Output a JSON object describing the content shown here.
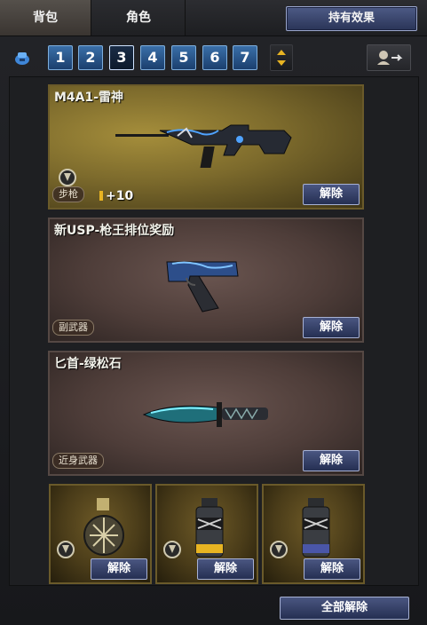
{
  "tabs": [
    {
      "label": "背包"
    },
    {
      "label": "角色"
    }
  ],
  "header": {
    "holding_effect_label": "持有效果"
  },
  "pagination": {
    "pages": [
      "1",
      "2",
      "3",
      "4",
      "5",
      "6",
      "7"
    ],
    "active_page": "3"
  },
  "cards": [
    {
      "title": "M4A1-雷神",
      "type": "步枪",
      "bonus": "+10",
      "unequip_label": "解除",
      "weapon_icon": "rifle-icon"
    },
    {
      "title": "新USP-枪王排位奖励",
      "type": "副武器",
      "unequip_label": "解除",
      "weapon_icon": "pistol-icon"
    },
    {
      "title": "匕首-绿松石",
      "type": "近身武器",
      "unequip_label": "解除",
      "weapon_icon": "knife-icon"
    }
  ],
  "slots": [
    {
      "unequip_label": "解除",
      "item_icon": "frag-grenade-icon"
    },
    {
      "unequip_label": "解除",
      "item_icon": "smoke-grenade-icon"
    },
    {
      "unequip_label": "解除",
      "item_icon": "flash-grenade-icon"
    }
  ],
  "footer": {
    "unequip_all_label": "全部解除"
  },
  "colors": {
    "accent": "#e8b422",
    "button": "#2f3a62",
    "gold_card": "#7c6a2c",
    "brown_card": "#4e3d39"
  }
}
